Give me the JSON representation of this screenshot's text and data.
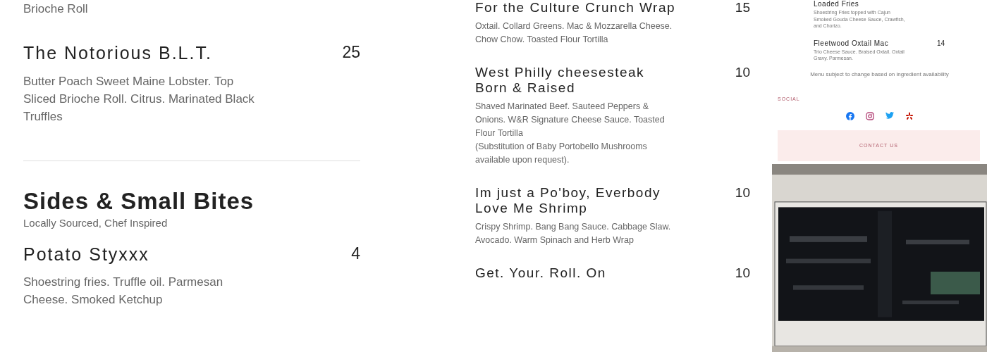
{
  "left": {
    "fragment": "Brioche Roll",
    "items": [
      {
        "name": "The Notorious B.L.T.",
        "price": "25",
        "description": [
          "Butter Poach Sweet Maine Lobster. Top Sliced Brioche Roll. Citrus. Marinated Black Truffles"
        ]
      }
    ],
    "section": {
      "title": "Sides & Small Bites",
      "subtitle": "Locally Sourced, Chef Inspired",
      "items": [
        {
          "name": "Potato Styxxx",
          "price": "4",
          "description": [
            "Shoestring fries. Truffle oil. Parmesan Cheese. Smoked Ketchup"
          ]
        }
      ]
    }
  },
  "middle": {
    "items": [
      {
        "name": "For the Culture Crunch Wrap",
        "price": "15",
        "description": [
          "Oxtail. Collard Greens. Mac & Mozzarella Cheese. Chow Chow. Toasted Flour Tortilla"
        ]
      },
      {
        "name": "West Philly cheesesteak Born & Raised",
        "price": "10",
        "description": [
          "Shaved Marinated Beef. Sauteed Peppers & Onions. W&R Signature Cheese Sauce.  Toasted Flour Tortilla",
          "(Substitution of Baby Portobello Mushrooms available upon request)."
        ]
      },
      {
        "name": "Im just a Po'boy, Everbody Love Me Shrimp",
        "price": "10",
        "description": [
          "Crispy Shrimp. Bang Bang Sauce. Cabbage Slaw. Avocado. Warm Spinach and Herb Wrap"
        ]
      },
      {
        "name": "Get. Your. Roll. On",
        "price": "10"
      }
    ]
  },
  "right": {
    "items": [
      {
        "name": "Loaded Fries",
        "description": "Shoestring Fries topped with Cajun Smoked Gouda Cheese Sauce, Crawfish, and Chorizo."
      },
      {
        "name": "Fleetwood Oxtail Mac",
        "price": "14",
        "description": "Trio Cheese Sauce. Braised Oxtail. Oxtail Gravy. Parmesan."
      }
    ],
    "note": "Menu subject to change based on ingredient availability",
    "social_label": "SOCIAL",
    "contact_button": "CONTACT US"
  }
}
